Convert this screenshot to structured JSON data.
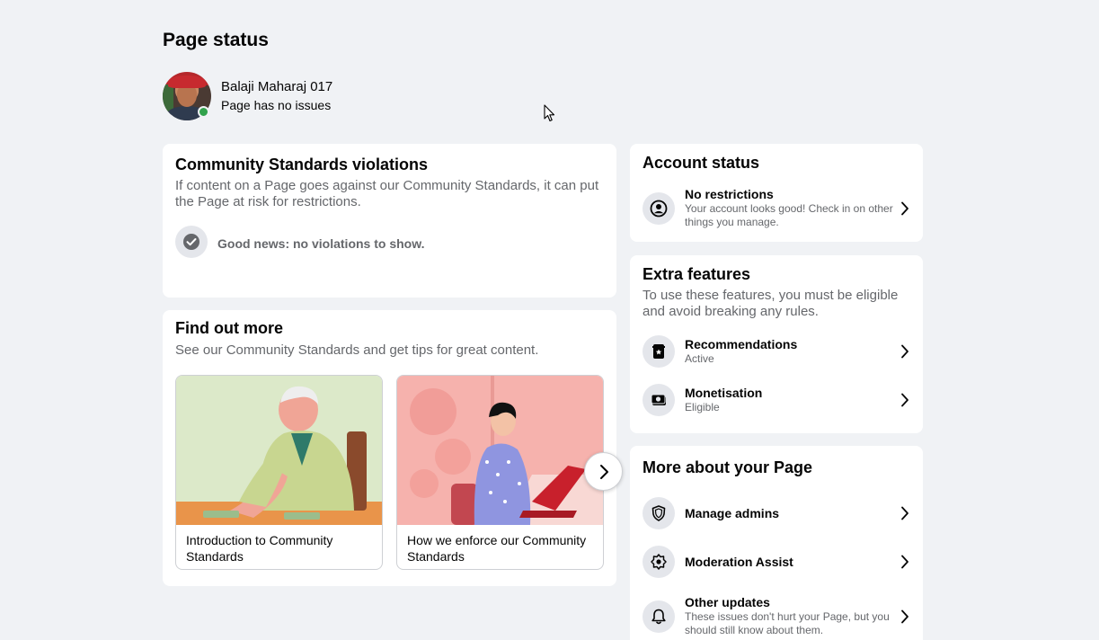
{
  "page": {
    "title": "Page status"
  },
  "profile": {
    "name": "Balaji Maharaj 017",
    "status": "Page has no issues"
  },
  "violations": {
    "title": "Community Standards violations",
    "description": "If content on a Page goes against our Community Standards, it can put the Page at risk for restrictions.",
    "status_text": "Good news: no violations to show."
  },
  "find_more": {
    "title": "Find out more",
    "description": "See our Community Standards and get tips for great content.",
    "tiles": [
      {
        "caption": "Introduction to Community Standards"
      },
      {
        "caption": "How we enforce our Community Standards"
      }
    ]
  },
  "account_status": {
    "title": "Account status",
    "item": {
      "label": "No restrictions",
      "sub": "Your account looks good! Check in on other things you manage."
    }
  },
  "extra_features": {
    "title": "Extra features",
    "description": "To use these features, you must be eligible and avoid breaking any rules.",
    "items": [
      {
        "label": "Recommendations",
        "sub": "Active"
      },
      {
        "label": "Monetisation",
        "sub": "Eligible"
      }
    ]
  },
  "more_about": {
    "title": "More about your Page",
    "items": [
      {
        "label": "Manage admins"
      },
      {
        "label": "Moderation Assist"
      },
      {
        "label": "Other updates",
        "sub": "These issues don't hurt your Page, but you should still know about them."
      }
    ]
  },
  "colors": {
    "background": "#f0f2f5",
    "card": "#ffffff",
    "secondary_text": "#65676b",
    "icon_bg": "#e4e6eb",
    "online": "#31a24c"
  }
}
